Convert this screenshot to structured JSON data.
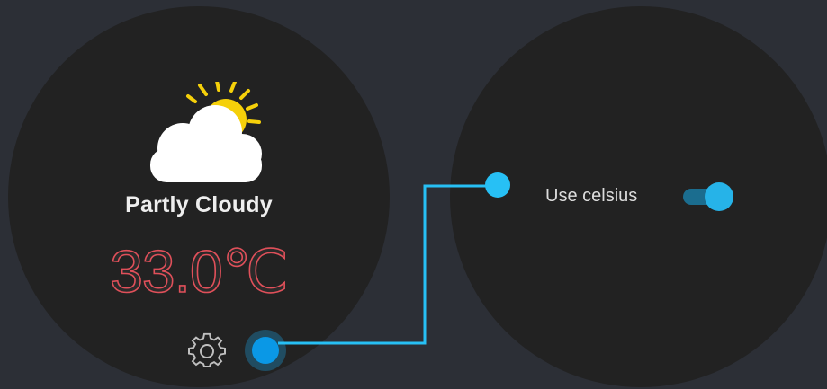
{
  "weather": {
    "condition": "Partly Cloudy",
    "temperature": "33.0℃",
    "icon": "partly-cloudy-icon"
  },
  "navigation": {
    "settings_icon": "gear-icon",
    "current_page_indicator": "page-indicator-dot"
  },
  "settings": {
    "use_celsius_label": "Use celsius",
    "use_celsius_enabled": true
  },
  "colors": {
    "background": "#2c2f36",
    "watch_face": "#222222",
    "temperature_outline": "#e0505a",
    "accent": "#27c0f5",
    "sun": "#f5d00a"
  }
}
